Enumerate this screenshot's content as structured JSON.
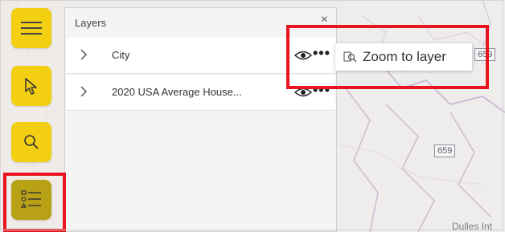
{
  "panel": {
    "title": "Layers",
    "close_glyph": "×",
    "layers": [
      {
        "label": "City",
        "expand_icon": "chevron-right-icon",
        "visibility_icon": "eye-icon",
        "more_glyph": "•••"
      },
      {
        "label": "2020 USA Average House...",
        "expand_icon": "chevron-right-icon",
        "visibility_icon": "eye-icon",
        "more_glyph": "•••"
      }
    ]
  },
  "context_menu": {
    "zoom_label": "Zoom to layer",
    "icon": "zoom-to-layer-icon"
  },
  "toolbar": {
    "buttons": [
      {
        "name": "menu",
        "icon": "hamburger-icon"
      },
      {
        "name": "select",
        "icon": "pointer-icon"
      },
      {
        "name": "search",
        "icon": "search-icon"
      },
      {
        "name": "layers",
        "icon": "layer-list-icon",
        "active": true
      }
    ]
  },
  "map": {
    "route_labels": [
      "659",
      "659"
    ],
    "place_label": "Dulles Int"
  },
  "colors": {
    "accent": "#f3cf12",
    "accent_active": "#b9a115",
    "highlight": "#e8141f"
  }
}
